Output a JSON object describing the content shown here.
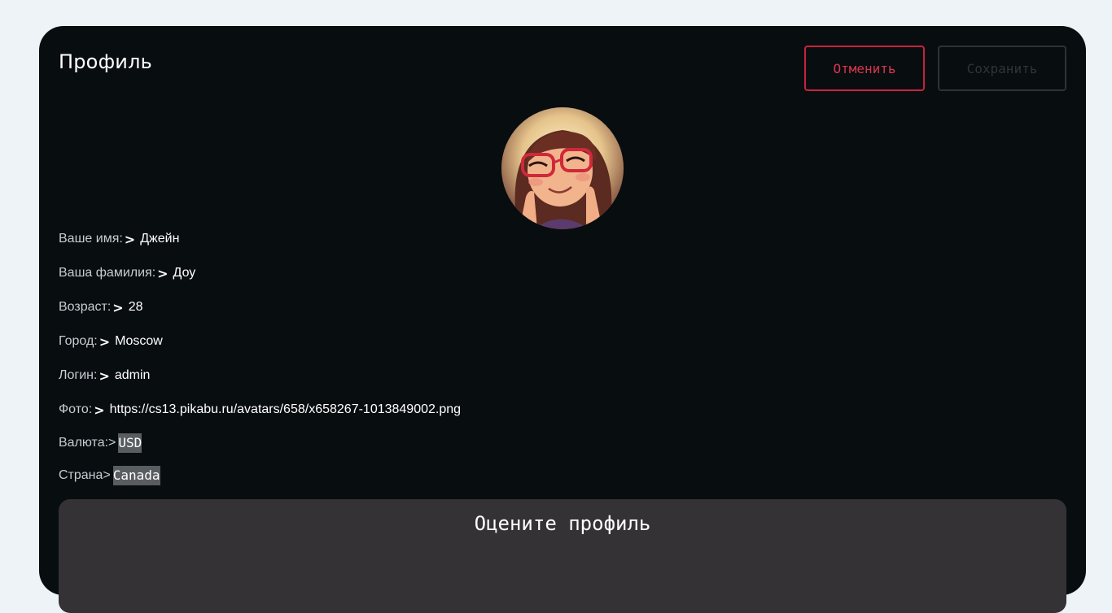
{
  "header": {
    "title": "Профиль",
    "cancel_label": "Отменить",
    "save_label": "Сохранить"
  },
  "avatar": {
    "icon": "avatar-portrait"
  },
  "fields": {
    "first_name": {
      "label": "Ваше имя:",
      "arrow": ">",
      "value": "Джейн"
    },
    "last_name": {
      "label": "Ваша фамилия:",
      "arrow": ">",
      "value": "Доу"
    },
    "age": {
      "label": "Возраст:",
      "arrow": ">",
      "value": "28"
    },
    "city": {
      "label": "Город:",
      "arrow": ">",
      "value": "Moscow"
    },
    "login": {
      "label": "Логин:",
      "arrow": ">",
      "value": "admin"
    },
    "photo": {
      "label": "Фото:",
      "arrow": ">",
      "value": "https://cs13.pikabu.ru/avatars/658/x658267-1013849002.png"
    },
    "currency": {
      "label": "Валюта:",
      "arrow": ">",
      "value": "USD"
    },
    "country": {
      "label": "Страна",
      "arrow": ">",
      "value": "Canada"
    }
  },
  "rating": {
    "title": "Оцените профиль"
  },
  "colors": {
    "page_bg": "#eef3f7",
    "card_bg": "#080d10",
    "cancel_accent": "#c7223d",
    "panel_bg": "#343234"
  }
}
